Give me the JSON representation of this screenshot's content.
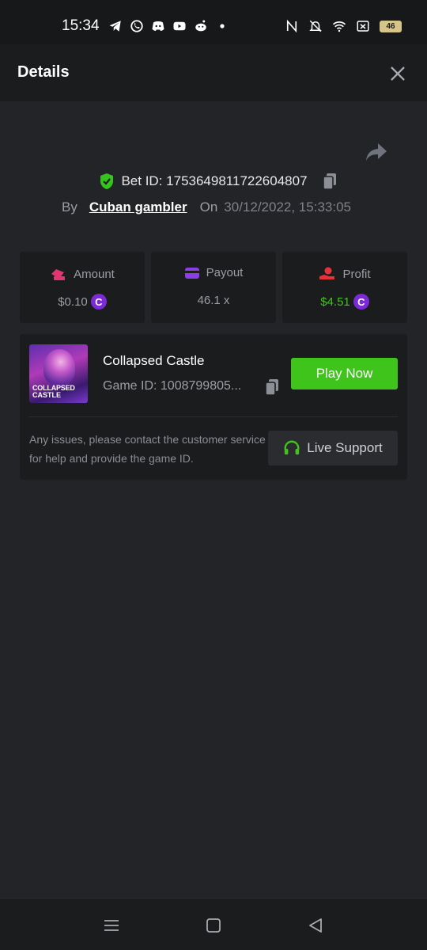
{
  "status_bar": {
    "time": "15:34",
    "battery": "46",
    "left_icons": [
      "telegram-icon",
      "whatsapp-icon",
      "discord-icon",
      "youtube-icon",
      "reddit-icon",
      "dot-icon"
    ],
    "right_icons": [
      "nfc-icon",
      "bell-muted-icon",
      "wifi-icon",
      "sim-x-icon",
      "battery-icon"
    ]
  },
  "header": {
    "title": "Details"
  },
  "bet": {
    "id_label": "Bet ID: 1753649811722604807",
    "by_label": "By",
    "username": "Cuban gambler",
    "on_label": "On",
    "date": "30/12/2022, 15:33:05"
  },
  "stats": {
    "amount": {
      "label": "Amount",
      "value": "$0.10"
    },
    "payout": {
      "label": "Payout",
      "value": "46.1 x"
    },
    "profit": {
      "label": "Profit",
      "value": "$4.51"
    },
    "coin_symbol": "C"
  },
  "game": {
    "thumb_line1": "COLLAPSED",
    "thumb_line2": "CASTLE",
    "name": "Collapsed Castle",
    "id_label": "Game ID: 1008799805...",
    "play_label": "Play Now",
    "help_text": "Any issues, please contact the customer service for help and provide the game ID.",
    "support_label": "Live Support"
  },
  "colors": {
    "accent_green": "#3ec41b",
    "profit_green": "#41c41d",
    "coin_purple": "#7b2bd6",
    "amount_icon": "#e0356f",
    "payout_icon": "#8a3ee6",
    "profit_icon": "#e5313a"
  }
}
